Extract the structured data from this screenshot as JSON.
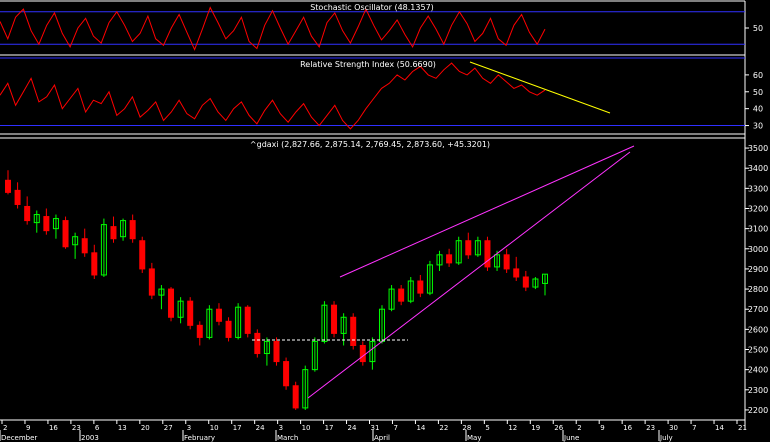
{
  "colors": {
    "background": "#000000",
    "band": "#3030ff",
    "panel_line": "#ffffff",
    "oscillator": "#ff0000",
    "up": "#00ff00",
    "down": "#ff0000",
    "wedge": "#ff33ff",
    "rsi_trend": "#ffff00",
    "support": "#ffffff"
  },
  "chart_data": [
    {
      "type": "line",
      "title": "Stochastic Oscillator (48.1357)",
      "series": [
        {
          "values": [
            62,
            30,
            70,
            85,
            45,
            20,
            55,
            78,
            40,
            15,
            50,
            68,
            35,
            22,
            60,
            80,
            55,
            25,
            40,
            72,
            30,
            18,
            50,
            75,
            42,
            10,
            48,
            88,
            60,
            30,
            45,
            70,
            25,
            12,
            55,
            82,
            50,
            20,
            45,
            70,
            35,
            15,
            60,
            78,
            45,
            22,
            52,
            85,
            55,
            28,
            45,
            65,
            38,
            15,
            50,
            72,
            48,
            20,
            55,
            80,
            58,
            25,
            40,
            68,
            30,
            18,
            55,
            75,
            42,
            20,
            48
          ]
        }
      ],
      "ylim": [
        0,
        100
      ],
      "bands": [
        80,
        20
      ],
      "yticks": [
        50
      ]
    },
    {
      "type": "line",
      "title": "Relative Strength Index (50.6690)",
      "series": [
        {
          "values": [
            48,
            55,
            42,
            50,
            58,
            44,
            47,
            54,
            40,
            46,
            52,
            38,
            45,
            43,
            50,
            36,
            40,
            47,
            35,
            39,
            44,
            33,
            38,
            45,
            37,
            34,
            42,
            46,
            38,
            33,
            40,
            44,
            36,
            31,
            39,
            45,
            37,
            32,
            38,
            43,
            35,
            30,
            36,
            42,
            33,
            28,
            33,
            40,
            46,
            52,
            55,
            60,
            57,
            62,
            65,
            60,
            58,
            63,
            67,
            62,
            60,
            64,
            58,
            55,
            60,
            56,
            52,
            54,
            50,
            48,
            51
          ]
        }
      ],
      "ylim": [
        25,
        70
      ],
      "bands": [
        70,
        30
      ],
      "yticks": [
        30,
        40,
        50,
        60
      ]
    },
    {
      "type": "candlestick",
      "title": "^gdaxi (2,827.66, 2,875.14, 2,769.45, 2,873.60, +45.3201)",
      "ylim": [
        2150,
        3550
      ],
      "yticks": [
        2200,
        2300,
        2400,
        2500,
        2600,
        2700,
        2800,
        2900,
        3000,
        3100,
        3200,
        3300,
        3400,
        3500
      ],
      "candles": [
        [
          3340,
          3390,
          3270,
          3280
        ],
        [
          3290,
          3330,
          3200,
          3220
        ],
        [
          3210,
          3260,
          3120,
          3140
        ],
        [
          3130,
          3190,
          3080,
          3170
        ],
        [
          3160,
          3200,
          3070,
          3090
        ],
        [
          3100,
          3170,
          3050,
          3150
        ],
        [
          3140,
          3160,
          3000,
          3010
        ],
        [
          3020,
          3080,
          2950,
          3060
        ],
        [
          3050,
          3100,
          2960,
          2980
        ],
        [
          2980,
          3020,
          2850,
          2870
        ],
        [
          2870,
          3150,
          2860,
          3120
        ],
        [
          3110,
          3160,
          3030,
          3050
        ],
        [
          3060,
          3150,
          3040,
          3140
        ],
        [
          3140,
          3170,
          3030,
          3050
        ],
        [
          3040,
          3060,
          2880,
          2900
        ],
        [
          2900,
          2930,
          2750,
          2770
        ],
        [
          2770,
          2820,
          2700,
          2800
        ],
        [
          2800,
          2810,
          2640,
          2660
        ],
        [
          2660,
          2760,
          2630,
          2740
        ],
        [
          2740,
          2760,
          2600,
          2620
        ],
        [
          2620,
          2640,
          2520,
          2560
        ],
        [
          2560,
          2720,
          2550,
          2700
        ],
        [
          2700,
          2730,
          2620,
          2640
        ],
        [
          2640,
          2660,
          2540,
          2560
        ],
        [
          2560,
          2730,
          2550,
          2710
        ],
        [
          2710,
          2720,
          2560,
          2580
        ],
        [
          2580,
          2600,
          2460,
          2480
        ],
        [
          2480,
          2560,
          2420,
          2540
        ],
        [
          2540,
          2560,
          2420,
          2440
        ],
        [
          2440,
          2460,
          2300,
          2320
        ],
        [
          2320,
          2340,
          2200,
          2210
        ],
        [
          2210,
          2420,
          2200,
          2400
        ],
        [
          2400,
          2560,
          2390,
          2540
        ],
        [
          2540,
          2740,
          2530,
          2720
        ],
        [
          2720,
          2740,
          2560,
          2580
        ],
        [
          2580,
          2680,
          2520,
          2660
        ],
        [
          2660,
          2680,
          2500,
          2520
        ],
        [
          2520,
          2540,
          2420,
          2440
        ],
        [
          2440,
          2560,
          2400,
          2540
        ],
        [
          2540,
          2720,
          2530,
          2700
        ],
        [
          2700,
          2820,
          2690,
          2800
        ],
        [
          2800,
          2820,
          2720,
          2740
        ],
        [
          2740,
          2860,
          2730,
          2840
        ],
        [
          2840,
          2870,
          2760,
          2780
        ],
        [
          2780,
          2940,
          2770,
          2920
        ],
        [
          2920,
          2990,
          2890,
          2970
        ],
        [
          2970,
          3000,
          2910,
          2930
        ],
        [
          2930,
          3060,
          2920,
          3040
        ],
        [
          3040,
          3080,
          2950,
          2970
        ],
        [
          2970,
          3060,
          2960,
          3040
        ],
        [
          3040,
          3060,
          2890,
          2910
        ],
        [
          2910,
          2990,
          2890,
          2970
        ],
        [
          2970,
          3000,
          2880,
          2900
        ],
        [
          2900,
          2960,
          2840,
          2860
        ],
        [
          2860,
          2890,
          2790,
          2810
        ],
        [
          2810,
          2860,
          2800,
          2850
        ],
        [
          2828,
          2875,
          2769,
          2874
        ]
      ]
    }
  ],
  "x_labels": {
    "days": [
      "2",
      "9",
      "16",
      "23",
      "6",
      "13",
      "20",
      "27",
      "3",
      "10",
      "17",
      "24",
      "3",
      "10",
      "17",
      "24",
      "31",
      "7",
      "14",
      "22",
      "28",
      "5",
      "12",
      "19",
      "26",
      "2",
      "9",
      "16",
      "23",
      "30",
      "7",
      "14",
      "21"
    ],
    "months": [
      "December",
      "2003",
      "February",
      "March",
      "April",
      "May",
      "June",
      "July"
    ]
  }
}
